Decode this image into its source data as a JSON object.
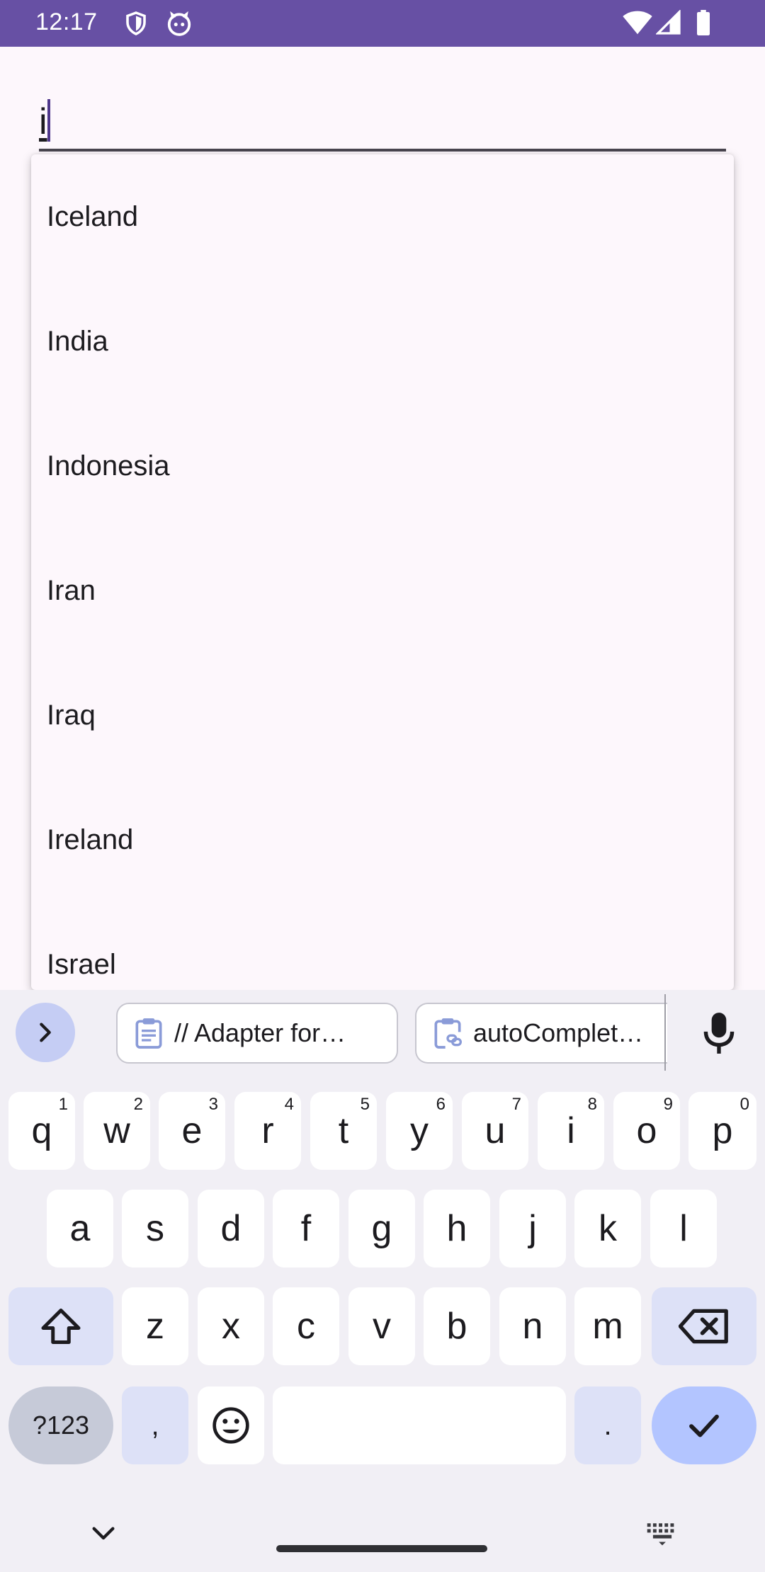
{
  "status_bar": {
    "time": "12:17",
    "icons": [
      "shield-icon",
      "cat-icon",
      "wifi-icon",
      "signal-icon",
      "battery-icon"
    ],
    "background": "#6750a4"
  },
  "input": {
    "value": "i"
  },
  "dropdown": {
    "items": [
      "Iceland",
      "India",
      "Indonesia",
      "Iran",
      "Iraq",
      "Ireland",
      "Israel"
    ]
  },
  "keyboard": {
    "clipboard_chips": [
      "// Adapter for…",
      "autoComplet…"
    ],
    "row1": [
      {
        "key": "q",
        "hint": "1"
      },
      {
        "key": "w",
        "hint": "2"
      },
      {
        "key": "e",
        "hint": "3"
      },
      {
        "key": "r",
        "hint": "4"
      },
      {
        "key": "t",
        "hint": "5"
      },
      {
        "key": "y",
        "hint": "6"
      },
      {
        "key": "u",
        "hint": "7"
      },
      {
        "key": "i",
        "hint": "8"
      },
      {
        "key": "o",
        "hint": "9"
      },
      {
        "key": "p",
        "hint": "0"
      }
    ],
    "row2": [
      "a",
      "s",
      "d",
      "f",
      "g",
      "h",
      "j",
      "k",
      "l"
    ],
    "row3": [
      "z",
      "x",
      "c",
      "v",
      "b",
      "n",
      "m"
    ],
    "symbols_label": "?123",
    "comma": ",",
    "period": ".",
    "accent_color": "#b3c5ff"
  }
}
